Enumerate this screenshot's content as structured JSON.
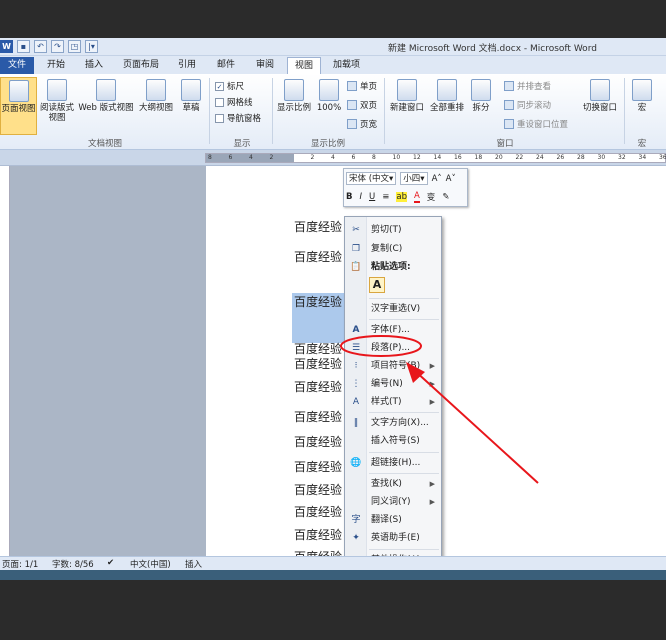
{
  "window": {
    "title": "新建 Microsoft Word 文档.docx - Microsoft Word"
  },
  "quick_access": {
    "word_logo": "W",
    "save": "▪",
    "undo": "↶",
    "redo": "↷",
    "preview": "◳",
    "customize": "|▾"
  },
  "tabs": [
    "文件",
    "开始",
    "插入",
    "页面布局",
    "引用",
    "邮件",
    "审阅",
    "视图",
    "加载项"
  ],
  "ribbon": {
    "doc_views": {
      "page_view": "页面视图",
      "reading": "阅读版式",
      "reading2": "视图",
      "web": "Web 版式视图",
      "outline": "大纲视图",
      "draft": "草稿",
      "group_label": "文档视图"
    },
    "show": {
      "ruler": "标尺",
      "gridlines": "网格线",
      "nav_pane": "导航窗格",
      "group_label": "显示",
      "ruler_checked": "✓"
    },
    "zoom": {
      "zoom": "显示比例",
      "percent": "100%",
      "one_page": "单页",
      "two_pages": "双页",
      "page_width": "页宽",
      "group_label": "显示比例"
    },
    "window": {
      "new_window": "新建窗口",
      "arrange_all": "全部重排",
      "split": "拆分",
      "side_by_side": "并排查看",
      "sync_scroll": "同步滚动",
      "reset_position": "重设窗口位置",
      "group_label": "窗口",
      "switch_window": "切换窗口"
    },
    "macros": {
      "macro": "宏",
      "group_label": "宏"
    }
  },
  "ruler": {
    "ticks": [
      "8",
      "6",
      "4",
      "2",
      "",
      "2",
      "4",
      "6",
      "8",
      "10",
      "12",
      "14",
      "16",
      "18",
      "20",
      "22",
      "24",
      "26",
      "28",
      "30",
      "32",
      "34",
      "36"
    ]
  },
  "document": {
    "lines": [
      "百度经验",
      "百度经验",
      "百度经验",
      "百度经验",
      "百度经验",
      "百度经验",
      "百度经验",
      "百度经验",
      "百度经验",
      "百度经验",
      "百度经验",
      "百度经验",
      "百度经验",
      "百度经验"
    ]
  },
  "minibar": {
    "font": "宋体 (中文▾",
    "size": "小四▾",
    "grow": "A˄",
    "shrink": "A˅",
    "bold": "B",
    "italic": "I",
    "underline": "U",
    "center": "≡",
    "highlight": "ab",
    "font_color": "A",
    "phonetic": "变",
    "format_painter": "✎"
  },
  "context_menu": {
    "cut": "剪切(T)",
    "copy": "复制(C)",
    "paste_options": "粘贴选项:",
    "paste_keep": "A",
    "han_reconvert": "汉字重选(V)",
    "font": "字体(F)...",
    "paragraph": "段落(P)...",
    "bullets": "项目符号(B)",
    "numbering": "编号(N)",
    "styles": "样式(T)",
    "text_direction": "文字方向(X)...",
    "insert_symbol": "插入符号(S)",
    "hyperlink": "超链接(H)...",
    "lookup": "查找(K)",
    "synonyms": "同义词(Y)",
    "translate": "翻译(S)",
    "english_assistant": "英语助手(E)",
    "other_actions": "其他操作(A)"
  },
  "statusbar": {
    "page": "页面: 1/1",
    "words": "字数: 8/56",
    "language": "中文(中国)",
    "mode": "插入"
  },
  "colors": {
    "accent": "#2a5aa8",
    "annotation": "#e8161b",
    "selection": "#acc9ec"
  }
}
